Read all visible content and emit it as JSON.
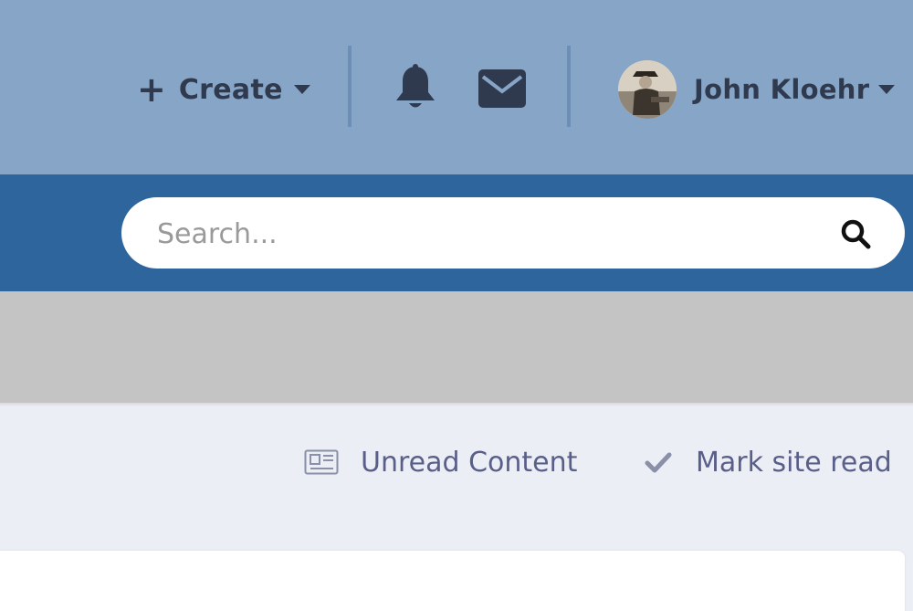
{
  "header": {
    "create_label": "Create",
    "user_name": "John Kloehr"
  },
  "search": {
    "placeholder": "Search..."
  },
  "actions": {
    "unread_label": "Unread Content",
    "mark_read_label": "Mark site read"
  },
  "colors": {
    "topbar": "#87a5c7",
    "searchbar": "#2e659d",
    "text_dark": "#2f3a4f",
    "action_text": "#5a5f8a"
  },
  "icons": [
    "plus-icon",
    "bell-icon",
    "envelope-icon",
    "search-icon",
    "newspaper-icon",
    "check-icon",
    "caret-down-icon"
  ]
}
